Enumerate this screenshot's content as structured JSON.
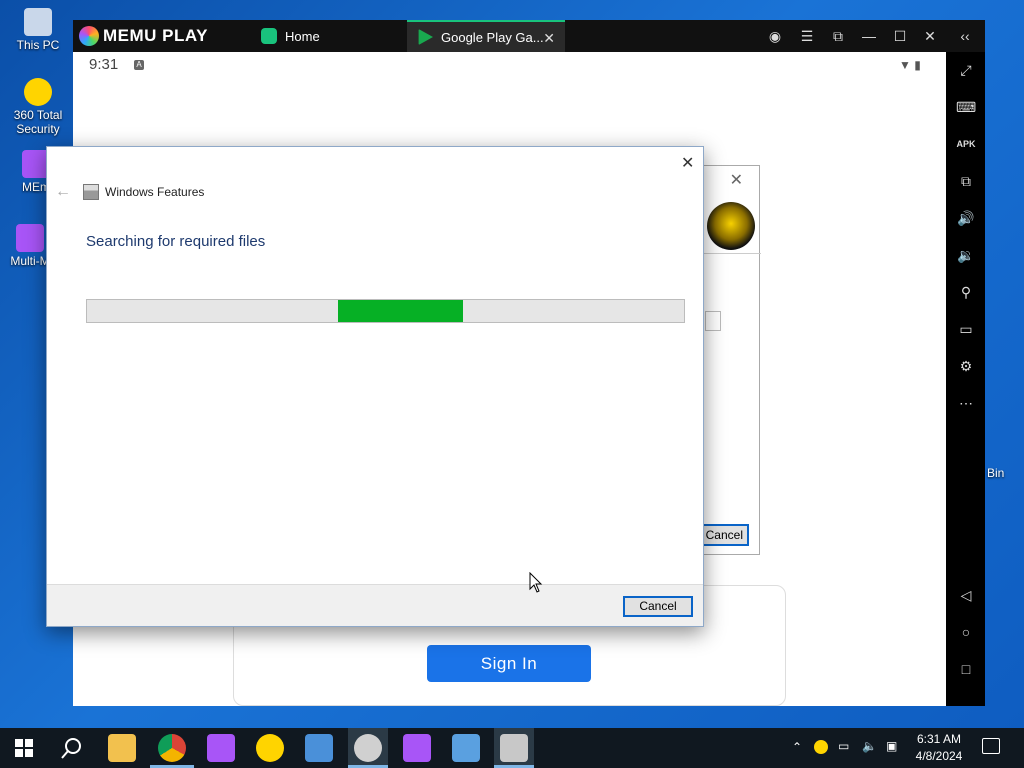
{
  "desktop": {
    "icons": [
      {
        "label": "This PC",
        "icon": "this-pc-icon",
        "color": "#c9d7ea"
      },
      {
        "label": "360 Total Security",
        "icon": "360-security-icon",
        "color": "#ffd400"
      },
      {
        "label": "MEm",
        "icon": "memu-icon",
        "color": "#a855f7"
      },
      {
        "label": "Multi-M",
        "icon": "multi-memu-icon",
        "color": "#a855f7"
      }
    ],
    "bin_label": "Bin"
  },
  "memu": {
    "brand": "MEMU PLAY",
    "tabs": [
      {
        "label": "Home",
        "icon": "memu-home-icon",
        "color": "#19c37d"
      },
      {
        "label": "Google Play Ga...",
        "icon": "google-play-games-icon",
        "color": "#19a84f"
      }
    ],
    "titlebar_buttons": [
      "account-icon",
      "menu-icon",
      "screenshot-icon",
      "minimize-icon",
      "maximize-icon",
      "close-icon",
      "collapse-sidebar-icon"
    ],
    "sidebar_buttons": [
      "fullscreen-icon",
      "keyboard-icon",
      "apk-icon",
      "multi-window-icon",
      "volume-up-icon",
      "volume-down-icon",
      "location-icon",
      "folder-icon",
      "settings-icon",
      "more-icon",
      "back-icon",
      "home-icon",
      "recents-icon"
    ],
    "android": {
      "time": "9:31",
      "status_a": "A",
      "signin_label": "Sign In"
    }
  },
  "bg_dialog": {
    "cancel_label": "Cancel"
  },
  "windows_features": {
    "title": "Windows Features",
    "heading": "Searching for required files",
    "progress": {
      "start": 0.42,
      "end": 0.63
    },
    "progress_color": "#06b025",
    "cancel_label": "Cancel"
  },
  "taskbar": {
    "apps": [
      {
        "icon": "file-explorer-icon",
        "color": "#f2c14e"
      },
      {
        "icon": "chrome-icon",
        "color": "#db4437"
      },
      {
        "icon": "memu-taskbar-icon",
        "color": "#a855f7"
      },
      {
        "icon": "360-taskbar-icon",
        "color": "#ffd400"
      },
      {
        "icon": "installer-icon",
        "color": "#4a90d9"
      },
      {
        "icon": "counter-strike-icon",
        "color": "#d0d0d0"
      },
      {
        "icon": "multi-memu-taskbar-icon",
        "color": "#a855f7"
      },
      {
        "icon": "control-panel-icon",
        "color": "#5aa0e0"
      },
      {
        "icon": "windows-features-icon",
        "color": "#c8c8c8"
      }
    ],
    "clock_time": "6:31 AM",
    "clock_date": "4/8/2024"
  }
}
